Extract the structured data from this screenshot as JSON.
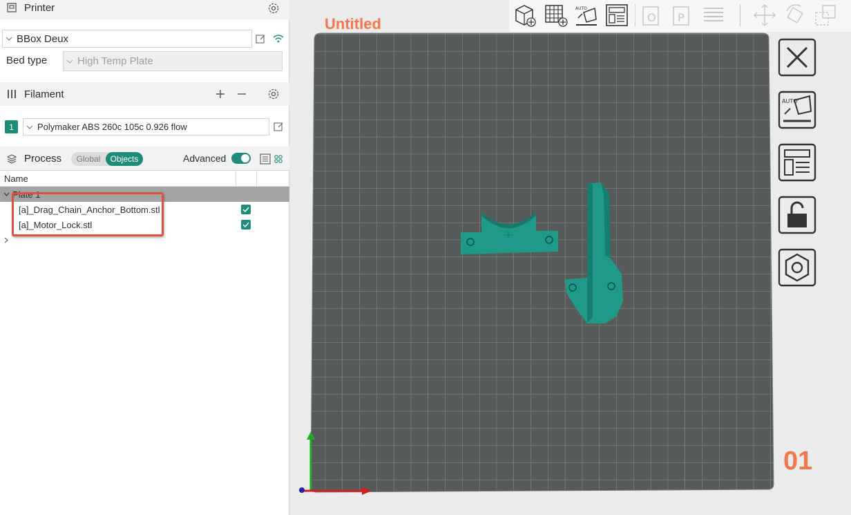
{
  "printer": {
    "section_title": "Printer",
    "printer_name": "BBox Deux",
    "bed_type_label": "Bed type",
    "bed_type_value": "High Temp Plate"
  },
  "filament": {
    "section_title": "Filament",
    "slot_number": "1",
    "filament_name": "Polymaker ABS 260c 105c 0.926 flow"
  },
  "process": {
    "section_title": "Process",
    "tabs": [
      {
        "label": "Global",
        "active": false
      },
      {
        "label": "Objects",
        "active": true
      }
    ],
    "advanced_label": "Advanced",
    "advanced_on": true
  },
  "object_list": {
    "column_name": "Name",
    "plate_label": "Plate 1",
    "objects": [
      {
        "name": "[a]_Drag_Chain_Anchor_Bottom.stl",
        "checked": true
      },
      {
        "name": "[a]_Motor_Lock.stl",
        "checked": true
      }
    ]
  },
  "canvas": {
    "project_title": "Untitled",
    "plate_number": "01"
  },
  "toolbar_icons": [
    "add-object-icon",
    "add-plate-icon",
    "auto-orient-icon",
    "arrange-icon",
    "split-objects-icon",
    "split-parts-icon",
    "layers-icon",
    "move-icon",
    "rotate-icon",
    "scale-icon"
  ],
  "side_icons": [
    "close-plate-icon",
    "auto-orient-plate-icon",
    "arrange-plate-icon",
    "lock-plate-icon",
    "plate-settings-icon"
  ],
  "colors": {
    "accent": "#1f8b7a",
    "brand_orange": "#f0784a",
    "model_teal": "#1f9a88",
    "bed_dark": "#565a5a",
    "highlight_red": "#e0503a"
  }
}
